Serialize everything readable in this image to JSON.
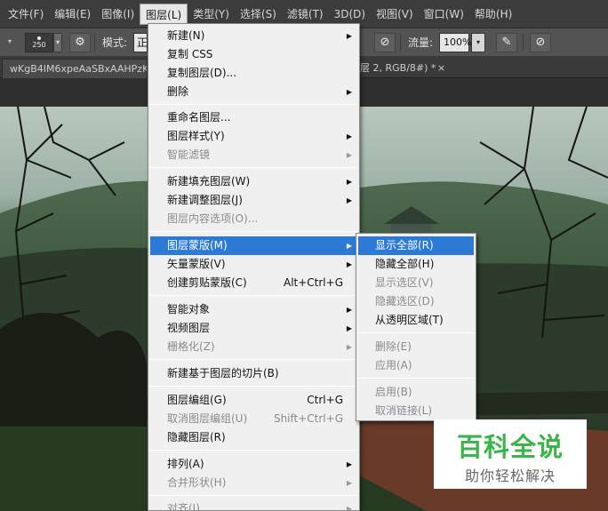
{
  "menubar": {
    "items": [
      {
        "label": "文件(F)"
      },
      {
        "label": "编辑(E)"
      },
      {
        "label": "图像(I)"
      },
      {
        "label": "图层(L)"
      },
      {
        "label": "类型(Y)"
      },
      {
        "label": "选择(S)"
      },
      {
        "label": "滤镜(T)"
      },
      {
        "label": "3D(D)"
      },
      {
        "label": "视图(V)"
      },
      {
        "label": "窗口(W)"
      },
      {
        "label": "帮助(H)"
      }
    ]
  },
  "options": {
    "brush_size": "250",
    "mode_label": "模式:",
    "mode_value": "正",
    "flow_label": "流量:",
    "flow_value": "100%"
  },
  "tabs": {
    "doc1": "wKgB4IM6xpeAaSBxAAHPzK",
    "doc2_suffix": "层 2, RGB/8#) *",
    "close": "×"
  },
  "layer_menu": {
    "items": [
      {
        "label": "新建(N)",
        "submenu": true
      },
      {
        "label": "复制 CSS"
      },
      {
        "label": "复制图层(D)..."
      },
      {
        "label": "删除",
        "submenu": true
      },
      {
        "label": "重命名图层..."
      },
      {
        "label": "图层样式(Y)",
        "submenu": true
      },
      {
        "label": "智能滤镜",
        "disabled": true,
        "submenu": true
      },
      {
        "label": "新建填充图层(W)",
        "submenu": true
      },
      {
        "label": "新建调整图层(J)",
        "submenu": true
      },
      {
        "label": "图层内容选项(O)...",
        "disabled": true
      },
      {
        "label": "图层蒙版(M)",
        "submenu": true,
        "highlighted": true
      },
      {
        "label": "矢量蒙版(V)",
        "submenu": true
      },
      {
        "label": "创建剪贴蒙版(C)",
        "shortcut": "Alt+Ctrl+G"
      },
      {
        "label": "智能对象",
        "submenu": true
      },
      {
        "label": "视频图层",
        "submenu": true
      },
      {
        "label": "栅格化(Z)",
        "disabled": true,
        "submenu": true
      },
      {
        "label": "新建基于图层的切片(B)"
      },
      {
        "label": "图层编组(G)",
        "shortcut": "Ctrl+G"
      },
      {
        "label": "取消图层编组(U)",
        "shortcut": "Shift+Ctrl+G",
        "disabled": true
      },
      {
        "label": "隐藏图层(R)"
      },
      {
        "label": "排列(A)",
        "submenu": true
      },
      {
        "label": "合并形状(H)",
        "disabled": true,
        "submenu": true
      },
      {
        "label": "对齐(I)",
        "disabled": true,
        "submenu": true
      }
    ]
  },
  "mask_submenu": {
    "items": [
      {
        "label": "显示全部(R)",
        "highlighted": true
      },
      {
        "label": "隐藏全部(H)"
      },
      {
        "label": "显示选区(V)",
        "disabled": true
      },
      {
        "label": "隐藏选区(D)",
        "disabled": true
      },
      {
        "label": "从透明区域(T)"
      },
      {
        "label": "删除(E)",
        "disabled": true
      },
      {
        "label": "应用(A)",
        "disabled": true
      },
      {
        "label": "启用(B)",
        "disabled": true
      },
      {
        "label": "取消链接(L)",
        "disabled": true
      }
    ]
  },
  "watermark": {
    "title": "百科全说",
    "subtitle": "助你轻松解决"
  },
  "colors": {
    "menu_highlight": "#2c7ad6",
    "watermark_green": "#3bb54a"
  }
}
